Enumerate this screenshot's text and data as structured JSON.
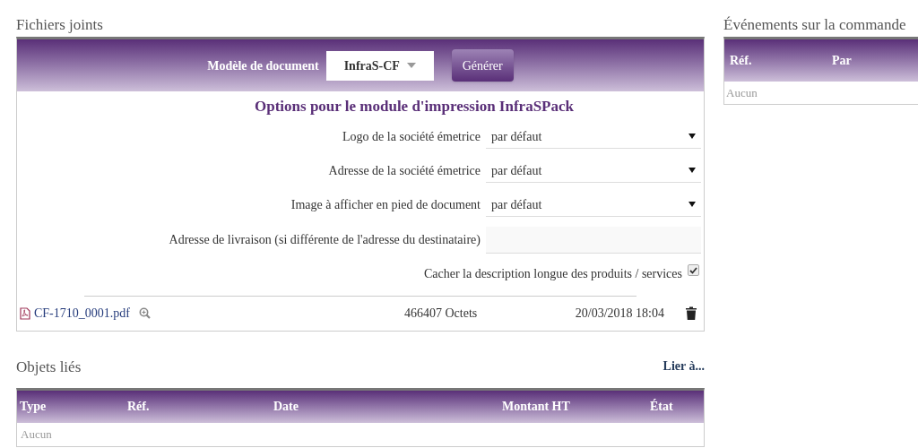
{
  "attachments": {
    "title": "Fichiers joints",
    "model_label": "Modèle de document",
    "model_value": "InfraS-CF",
    "generate_button": "Générer",
    "options_title": "Options pour le module d'impression InfraSPack",
    "options": [
      {
        "kind": "select",
        "label": "Logo de la société émetrice",
        "value": "par défaut"
      },
      {
        "kind": "select",
        "label": "Adresse de la société émetrice",
        "value": "par défaut"
      },
      {
        "kind": "select",
        "label": "Image à afficher en pied de document",
        "value": "par défaut"
      },
      {
        "kind": "text",
        "label": "Adresse de livraison (si différente de l'adresse du destinataire)"
      },
      {
        "kind": "checkbox",
        "label": "Cacher la description longue des produits / services",
        "checked": true
      }
    ],
    "files": [
      {
        "name": "CF-1710_0001.pdf",
        "size": "466407 Octets",
        "date": "20/03/2018 18:04"
      }
    ]
  },
  "linked_objects": {
    "title": "Objets liés",
    "link": "Lier à...",
    "columns": [
      "Type",
      "Réf.",
      "Date",
      "Montant HT",
      "État"
    ],
    "empty": "Aucun"
  },
  "events": {
    "title": "Événements sur la commande",
    "columns": [
      "Réf.",
      "Par"
    ],
    "empty": "Aucun"
  }
}
